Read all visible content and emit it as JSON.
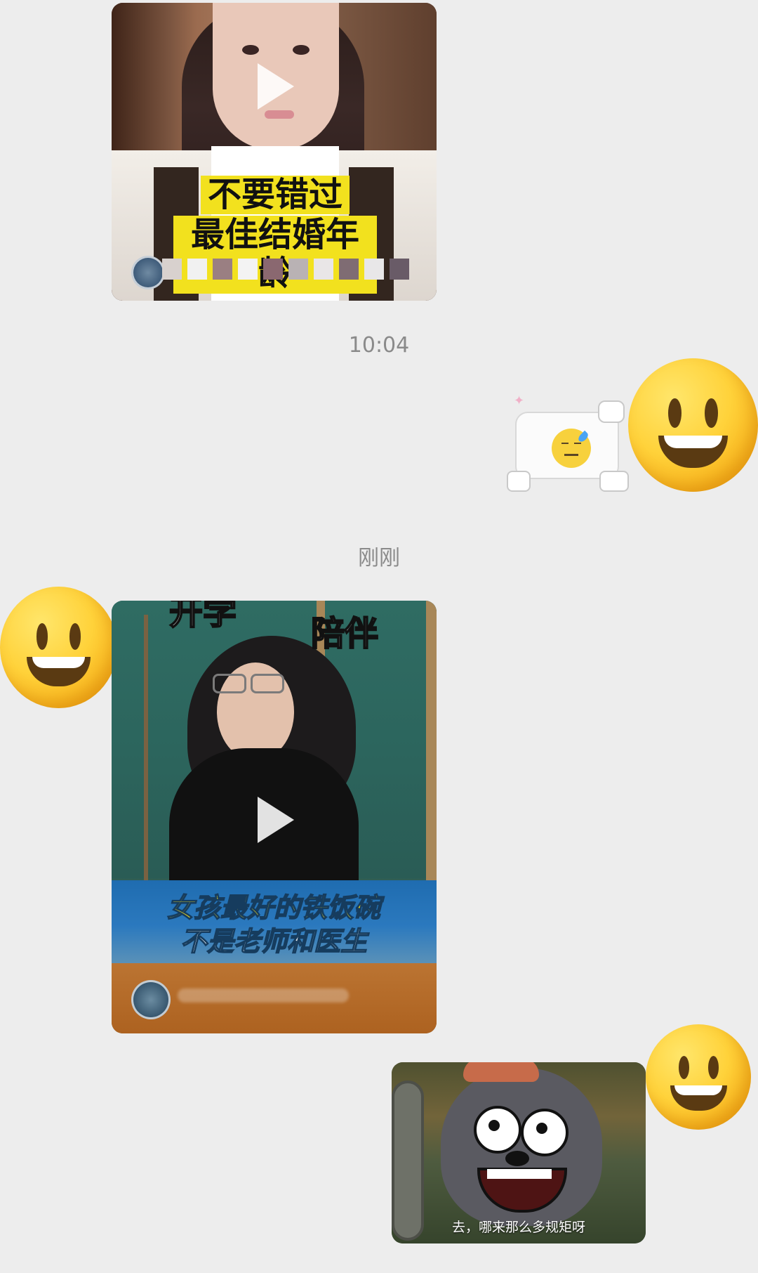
{
  "messages": [
    {
      "type": "video",
      "caption_lines": [
        "不要错过",
        "最佳结婚年龄"
      ]
    },
    {
      "type": "timestamp",
      "text": "10:04"
    },
    {
      "type": "sticker",
      "description_icon": "sleepy-sweat-emoji-sticker"
    },
    {
      "type": "timestamp",
      "text": "刚刚"
    },
    {
      "type": "video",
      "top_labels": [
        "开学",
        "陪伴"
      ],
      "caption_lines": [
        "女孩最好的铁饭碗",
        "不是老师和医生"
      ]
    },
    {
      "type": "image",
      "subtitle": "去，哪来那么多规矩呀"
    }
  ],
  "colors": {
    "background": "#ededed",
    "caption_yellow": "#f2e11e",
    "blue_banner": "#2f80c8",
    "timestamp_gray": "#8a8a8a"
  }
}
